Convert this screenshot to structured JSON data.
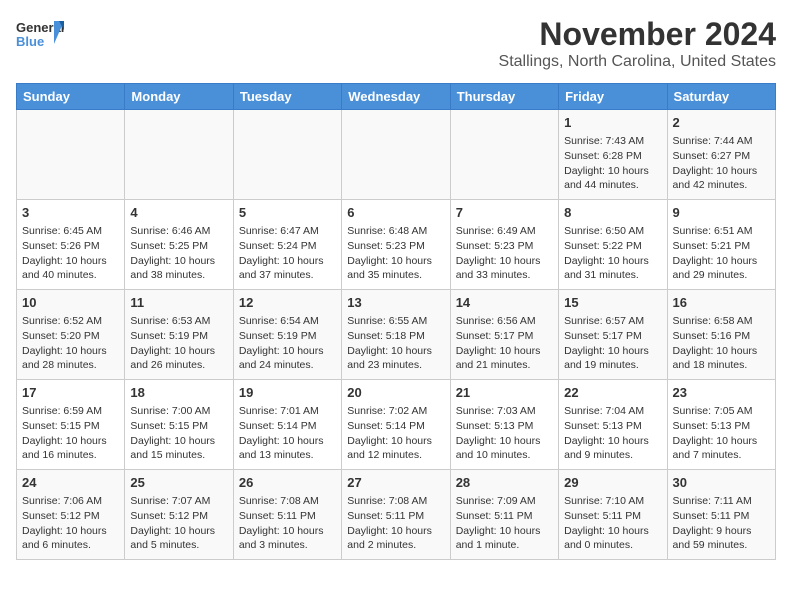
{
  "logo": {
    "line1": "General",
    "line2": "Blue"
  },
  "title": "November 2024",
  "subtitle": "Stallings, North Carolina, United States",
  "days_of_week": [
    "Sunday",
    "Monday",
    "Tuesday",
    "Wednesday",
    "Thursday",
    "Friday",
    "Saturday"
  ],
  "weeks": [
    [
      {
        "day": "",
        "info": ""
      },
      {
        "day": "",
        "info": ""
      },
      {
        "day": "",
        "info": ""
      },
      {
        "day": "",
        "info": ""
      },
      {
        "day": "",
        "info": ""
      },
      {
        "day": "1",
        "info": "Sunrise: 7:43 AM\nSunset: 6:28 PM\nDaylight: 10 hours and 44 minutes."
      },
      {
        "day": "2",
        "info": "Sunrise: 7:44 AM\nSunset: 6:27 PM\nDaylight: 10 hours and 42 minutes."
      }
    ],
    [
      {
        "day": "3",
        "info": "Sunrise: 6:45 AM\nSunset: 5:26 PM\nDaylight: 10 hours and 40 minutes."
      },
      {
        "day": "4",
        "info": "Sunrise: 6:46 AM\nSunset: 5:25 PM\nDaylight: 10 hours and 38 minutes."
      },
      {
        "day": "5",
        "info": "Sunrise: 6:47 AM\nSunset: 5:24 PM\nDaylight: 10 hours and 37 minutes."
      },
      {
        "day": "6",
        "info": "Sunrise: 6:48 AM\nSunset: 5:23 PM\nDaylight: 10 hours and 35 minutes."
      },
      {
        "day": "7",
        "info": "Sunrise: 6:49 AM\nSunset: 5:23 PM\nDaylight: 10 hours and 33 minutes."
      },
      {
        "day": "8",
        "info": "Sunrise: 6:50 AM\nSunset: 5:22 PM\nDaylight: 10 hours and 31 minutes."
      },
      {
        "day": "9",
        "info": "Sunrise: 6:51 AM\nSunset: 5:21 PM\nDaylight: 10 hours and 29 minutes."
      }
    ],
    [
      {
        "day": "10",
        "info": "Sunrise: 6:52 AM\nSunset: 5:20 PM\nDaylight: 10 hours and 28 minutes."
      },
      {
        "day": "11",
        "info": "Sunrise: 6:53 AM\nSunset: 5:19 PM\nDaylight: 10 hours and 26 minutes."
      },
      {
        "day": "12",
        "info": "Sunrise: 6:54 AM\nSunset: 5:19 PM\nDaylight: 10 hours and 24 minutes."
      },
      {
        "day": "13",
        "info": "Sunrise: 6:55 AM\nSunset: 5:18 PM\nDaylight: 10 hours and 23 minutes."
      },
      {
        "day": "14",
        "info": "Sunrise: 6:56 AM\nSunset: 5:17 PM\nDaylight: 10 hours and 21 minutes."
      },
      {
        "day": "15",
        "info": "Sunrise: 6:57 AM\nSunset: 5:17 PM\nDaylight: 10 hours and 19 minutes."
      },
      {
        "day": "16",
        "info": "Sunrise: 6:58 AM\nSunset: 5:16 PM\nDaylight: 10 hours and 18 minutes."
      }
    ],
    [
      {
        "day": "17",
        "info": "Sunrise: 6:59 AM\nSunset: 5:15 PM\nDaylight: 10 hours and 16 minutes."
      },
      {
        "day": "18",
        "info": "Sunrise: 7:00 AM\nSunset: 5:15 PM\nDaylight: 10 hours and 15 minutes."
      },
      {
        "day": "19",
        "info": "Sunrise: 7:01 AM\nSunset: 5:14 PM\nDaylight: 10 hours and 13 minutes."
      },
      {
        "day": "20",
        "info": "Sunrise: 7:02 AM\nSunset: 5:14 PM\nDaylight: 10 hours and 12 minutes."
      },
      {
        "day": "21",
        "info": "Sunrise: 7:03 AM\nSunset: 5:13 PM\nDaylight: 10 hours and 10 minutes."
      },
      {
        "day": "22",
        "info": "Sunrise: 7:04 AM\nSunset: 5:13 PM\nDaylight: 10 hours and 9 minutes."
      },
      {
        "day": "23",
        "info": "Sunrise: 7:05 AM\nSunset: 5:13 PM\nDaylight: 10 hours and 7 minutes."
      }
    ],
    [
      {
        "day": "24",
        "info": "Sunrise: 7:06 AM\nSunset: 5:12 PM\nDaylight: 10 hours and 6 minutes."
      },
      {
        "day": "25",
        "info": "Sunrise: 7:07 AM\nSunset: 5:12 PM\nDaylight: 10 hours and 5 minutes."
      },
      {
        "day": "26",
        "info": "Sunrise: 7:08 AM\nSunset: 5:11 PM\nDaylight: 10 hours and 3 minutes."
      },
      {
        "day": "27",
        "info": "Sunrise: 7:08 AM\nSunset: 5:11 PM\nDaylight: 10 hours and 2 minutes."
      },
      {
        "day": "28",
        "info": "Sunrise: 7:09 AM\nSunset: 5:11 PM\nDaylight: 10 hours and 1 minute."
      },
      {
        "day": "29",
        "info": "Sunrise: 7:10 AM\nSunset: 5:11 PM\nDaylight: 10 hours and 0 minutes."
      },
      {
        "day": "30",
        "info": "Sunrise: 7:11 AM\nSunset: 5:11 PM\nDaylight: 9 hours and 59 minutes."
      }
    ]
  ]
}
